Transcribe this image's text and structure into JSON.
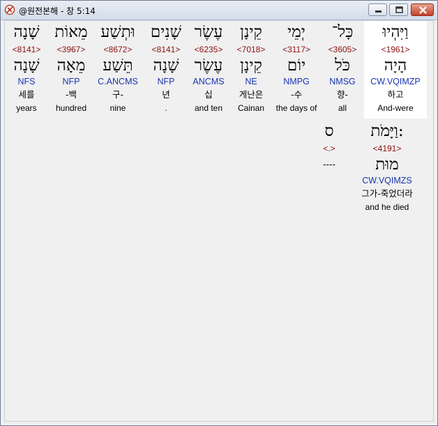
{
  "window": {
    "title": "@원전본해 - 창 5:14"
  },
  "colors": {
    "strong": "#8b1010",
    "morph": "#1a35b0",
    "selected_bg": "#ffffff"
  },
  "line1": [
    {
      "heb": "וַיִּהְיוּ",
      "strong": "<1961>",
      "lemma": "הָיָה",
      "morph": "CW.VQIMZP",
      "kor": "하고",
      "eng": "And-were",
      "selected": true
    },
    {
      "heb": "כָּל־",
      "strong": "<3605>",
      "lemma": "כֹּל",
      "morph": "NMSG",
      "kor": "향-",
      "eng": "all"
    },
    {
      "heb": "יְמֵי",
      "strong": "<3117>",
      "lemma": "יוֹם",
      "morph": "NMPG",
      "kor": "-수",
      "eng": "the days of"
    },
    {
      "heb": "קֵינָן",
      "strong": "<7018>",
      "lemma": "קֵינָן",
      "morph": "NE",
      "kor": "게난은",
      "eng": "Cainan"
    },
    {
      "heb": "עֶשֶׂר",
      "strong": "<6235>",
      "lemma": "עֶשֶׂר",
      "morph": "ANCMS",
      "kor": "십",
      "eng": "and ten"
    },
    {
      "heb": "שָׁנִים",
      "strong": "<8141>",
      "lemma": "שָׁנָה",
      "morph": "NFP",
      "kor": "년",
      "eng": "."
    },
    {
      "heb": "וּתְשַׁע",
      "strong": "<8672>",
      "lemma": "תֵּשַׁע",
      "morph": "C.ANCMS",
      "kor": "구-",
      "eng": "nine"
    },
    {
      "heb": "מֵאוֹת",
      "strong": "<3967>",
      "lemma": "מֵאָה",
      "morph": "NFP",
      "kor": "-백",
      "eng": "hundred"
    },
    {
      "heb": "שָׁנָה",
      "strong": "<8141>",
      "lemma": "שָׁנָה",
      "morph": "NFS",
      "kor": "세를",
      "eng": "years"
    }
  ],
  "line2": [
    {
      "heb": "וַיָּמֹת:",
      "strong": "<4191>",
      "lemma": "מוּת",
      "morph": "CW.VQIMZS",
      "kor": "그가-죽었더라",
      "eng": "and he died"
    },
    {
      "heb": "ס",
      "strong": "<.>",
      "lemma": "----",
      "morph": "",
      "kor": "",
      "eng": ""
    }
  ]
}
